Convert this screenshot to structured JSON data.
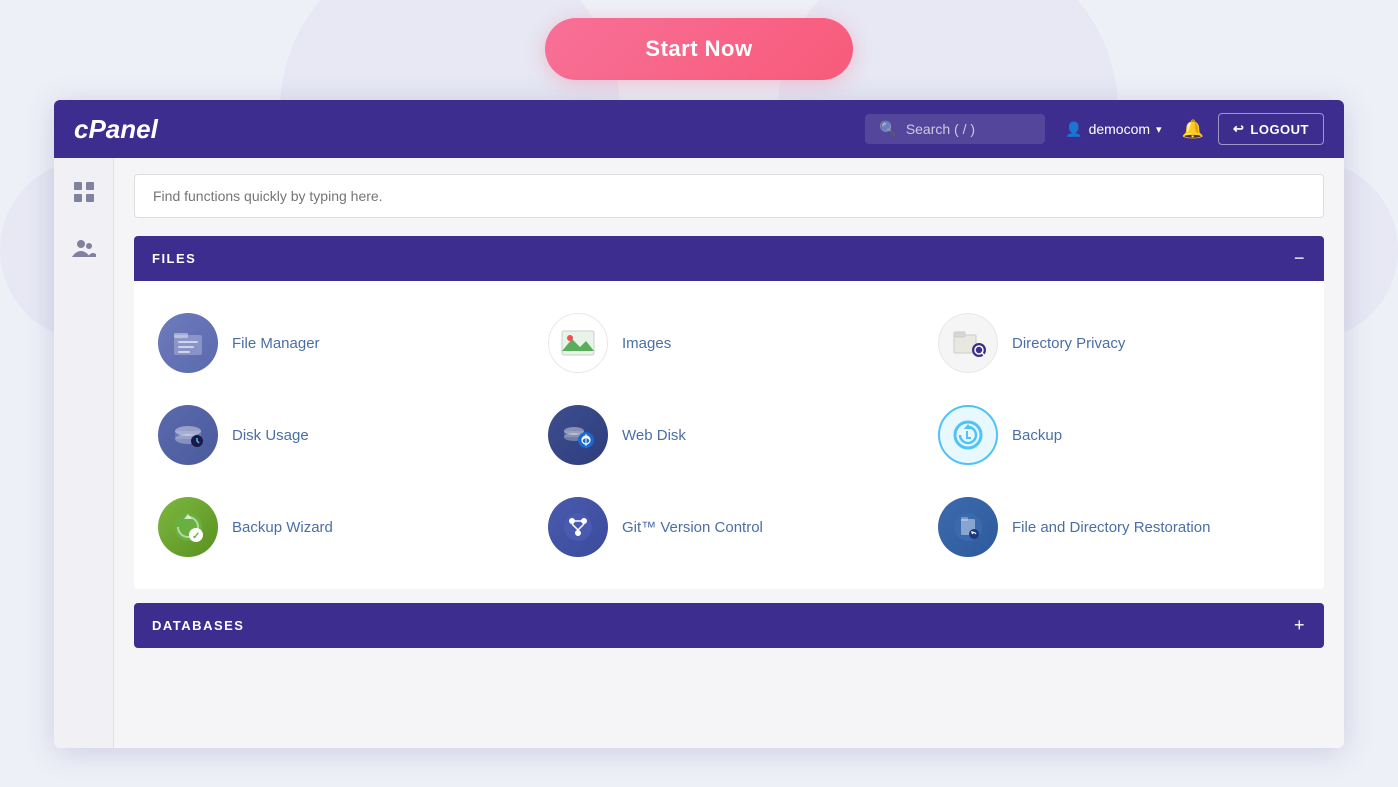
{
  "top": {
    "start_now_label": "Start Now"
  },
  "header": {
    "logo": "cPanel",
    "search_placeholder": "Search ( / )",
    "user": "democom",
    "logout_label": "LOGOUT"
  },
  "sidebar": {
    "items": [
      {
        "icon": "grid-icon",
        "label": "Grid"
      },
      {
        "icon": "users-icon",
        "label": "Users"
      }
    ]
  },
  "main": {
    "search_placeholder": "Find functions quickly by typing here.",
    "sections": [
      {
        "id": "files",
        "title": "FILES",
        "toggle": "−",
        "expanded": true,
        "items": [
          {
            "id": "file-manager",
            "label": "File Manager",
            "icon": "file-manager-icon"
          },
          {
            "id": "images",
            "label": "Images",
            "icon": "images-icon"
          },
          {
            "id": "directory-privacy",
            "label": "Directory Privacy",
            "icon": "directory-privacy-icon"
          },
          {
            "id": "disk-usage",
            "label": "Disk Usage",
            "icon": "disk-usage-icon"
          },
          {
            "id": "web-disk",
            "label": "Web Disk",
            "icon": "web-disk-icon"
          },
          {
            "id": "backup",
            "label": "Backup",
            "icon": "backup-icon"
          },
          {
            "id": "backup-wizard",
            "label": "Backup Wizard",
            "icon": "backup-wizard-icon"
          },
          {
            "id": "git-version-control",
            "label": "Git™ Version Control",
            "icon": "git-icon"
          },
          {
            "id": "file-directory-restoration",
            "label": "File and Directory Restoration",
            "icon": "file-restore-icon"
          }
        ]
      },
      {
        "id": "databases",
        "title": "DATABASES",
        "toggle": "+",
        "expanded": false,
        "items": []
      }
    ]
  }
}
